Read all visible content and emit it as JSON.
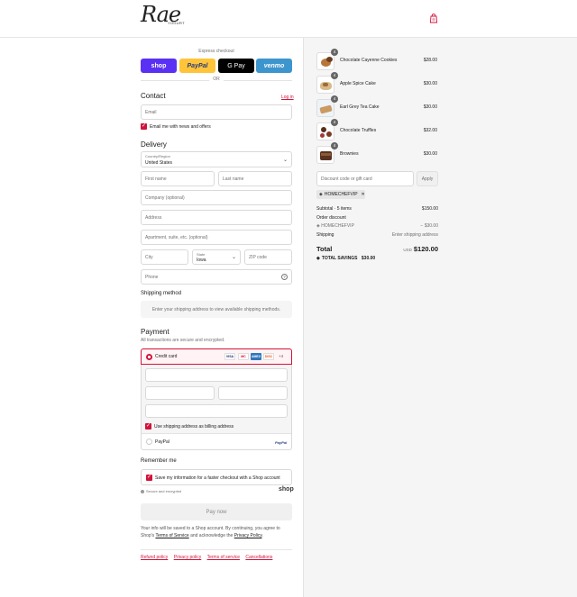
{
  "header": {
    "logo_script": "Rae",
    "logo_small": "YOGURT",
    "cart_icon": "shopping-bag-icon"
  },
  "express": {
    "label": "Express checkout",
    "shop": "shop",
    "paypal": "PayPal",
    "gpay": "G Pay",
    "venmo": "venmo",
    "or": "OR"
  },
  "contact": {
    "heading": "Contact",
    "login": "Log in",
    "email_placeholder": "Email",
    "news_label": "Email me with news and offers"
  },
  "delivery": {
    "heading": "Delivery",
    "country_label": "Country/Region",
    "country_value": "United States",
    "first_name": "First name",
    "last_name": "Last name",
    "company": "Company (optional)",
    "address": "Address",
    "apartment": "Apartment, suite, etc. (optional)",
    "city": "City",
    "state_label": "State",
    "state_value": "Iowa",
    "zip": "ZIP code",
    "phone": "Phone"
  },
  "shipping": {
    "heading": "Shipping method",
    "message": "Enter your shipping address to view available shipping methods."
  },
  "payment": {
    "heading": "Payment",
    "subtitle": "All transactions are secure and encrypted.",
    "credit_card": "Credit card",
    "cards": [
      "VISA",
      "MC",
      "AMEX",
      "DISC"
    ],
    "more": "+4",
    "billing_label": "Use shipping address as billing address",
    "paypal": "PayPal",
    "paypal_logo": "PayPal"
  },
  "remember": {
    "heading": "Remember me",
    "label": "Save my information for a faster checkout with a Shop account",
    "secure": "Secure and encrypted",
    "shop": "shop"
  },
  "pay_now": "Pay now",
  "legal": {
    "line1": "Your info will be saved to a Shop account. By continuing, you agree to Shop's",
    "terms": "Terms of Service",
    "mid": "and acknowledge the",
    "privacy": "Privacy Policy",
    "end": "."
  },
  "footer": {
    "links": [
      "Refund policy",
      "Privacy policy",
      "Terms of service",
      "Cancellations"
    ]
  },
  "cart": {
    "items": [
      {
        "name": "Chocolate Cayenne Cookies",
        "qty": "4",
        "price": "$28.00"
      },
      {
        "name": "Apple Spice Cake",
        "qty": "4",
        "price": "$30.00"
      },
      {
        "name": "Earl Grey Tea Cake",
        "qty": "4",
        "price": "$30.00"
      },
      {
        "name": "Chocolate Truffles",
        "qty": "4",
        "price": "$32.00"
      },
      {
        "name": "Brownies",
        "qty": "4",
        "price": "$30.00"
      }
    ],
    "discount_placeholder": "Discount code or gift card",
    "apply": "Apply",
    "code_tag": "HOMECHEFVIP",
    "subtotal_label": "Subtotal · 5 items",
    "subtotal_value": "$150.00",
    "order_discount": "Order discount",
    "discount_code": "HOMECHEFVIP",
    "discount_value": "− $30.00",
    "shipping_label": "Shipping",
    "shipping_value": "Enter shipping address",
    "total_label": "Total",
    "currency": "USD",
    "total_value": "$120.00",
    "savings_label": "TOTAL SAVINGS",
    "savings_value": "$30.00"
  }
}
